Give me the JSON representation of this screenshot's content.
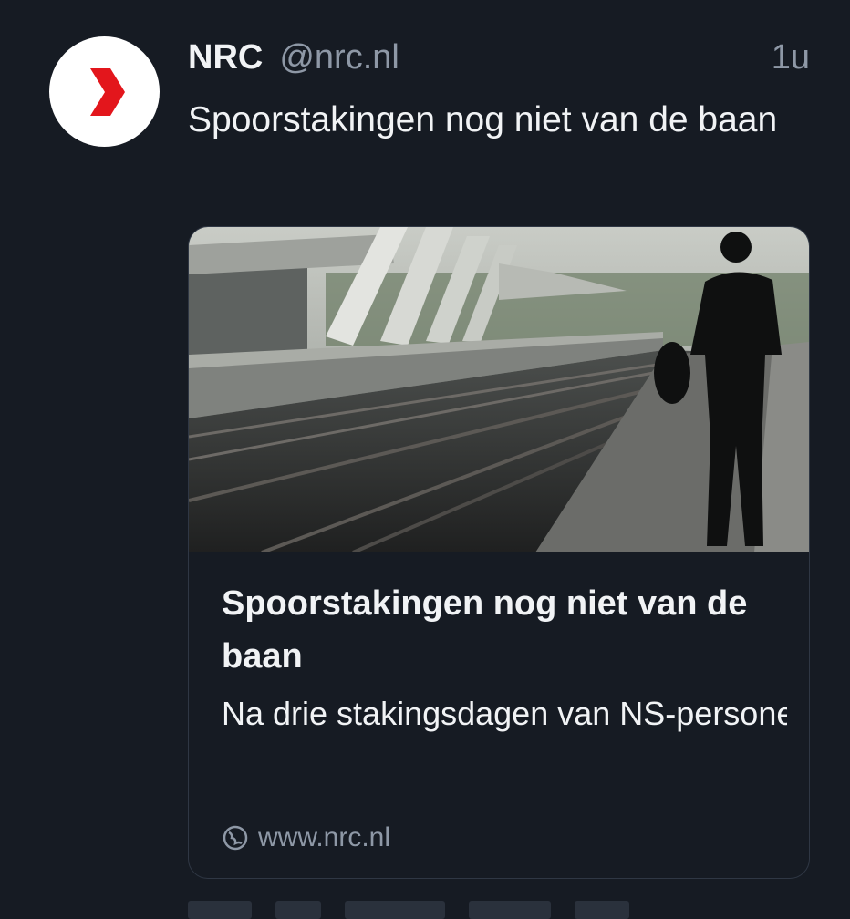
{
  "tweet": {
    "author_name": "NRC",
    "handle": "@nrc.nl",
    "time": "1u",
    "text": "Spoorstakingen nog niet van de baan",
    "avatar_icon": "nrc-logo-icon",
    "avatar_color": "#e3161c"
  },
  "card": {
    "image_alt": "treinsporen-station-foto",
    "title": "Spoorstakingen nog niet van de baan",
    "description": "Na drie stakingsdagen van NS-personeel kwam de directi...",
    "domain": "www.nrc.nl",
    "domain_icon": "globe-icon"
  },
  "colors": {
    "background": "#161b23",
    "text": "#f1f3f5",
    "muted": "#8e98a6",
    "border": "#2f3744"
  }
}
